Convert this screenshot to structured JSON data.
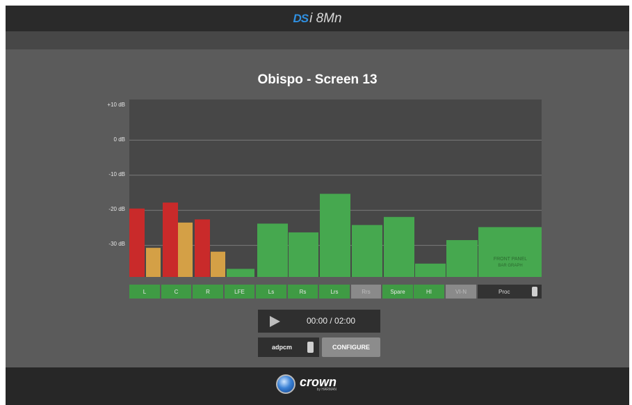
{
  "header": {
    "brand_mark": "DS",
    "brand_model": "i 8Mn"
  },
  "page": {
    "title": "Obispo - Screen 13"
  },
  "meter": {
    "y_labels": [
      "+10 dB",
      "0 dB",
      "-10 dB",
      "-20 dB",
      "-30 dB"
    ],
    "annotation_line1": "FRONT PANEL",
    "annotation_line2": "BAR GRAPH"
  },
  "chart_data": {
    "type": "bar",
    "ylim": [
      -40,
      10
    ],
    "bars": [
      {
        "channel": "L",
        "color": "#c92a2a",
        "value": -19.5
      },
      {
        "channel": "L",
        "color": "#d4a046",
        "value": -30.7
      },
      {
        "channel": "C",
        "color": "#c92a2a",
        "value": -17.8
      },
      {
        "channel": "C",
        "color": "#d4a046",
        "value": -23.5
      },
      {
        "channel": "R",
        "color": "#c92a2a",
        "value": -22.6
      },
      {
        "channel": "R",
        "color": "#d4a046",
        "value": -31.8
      },
      {
        "channel": "LFE",
        "color": "#46a84f",
        "value": -36.7
      },
      {
        "channel": "Ls",
        "color": "#46a84f",
        "value": -23.8
      },
      {
        "channel": "Rs",
        "color": "#46a84f",
        "value": -26.3
      },
      {
        "channel": "Lrs",
        "color": "#46a84f",
        "value": -15.3
      },
      {
        "channel": "Rrs",
        "color": "#46a84f",
        "value": -24.2
      },
      {
        "channel": "Spare",
        "color": "#46a84f",
        "value": -21.9
      },
      {
        "channel": "HI",
        "color": "#46a84f",
        "value": -35.2
      },
      {
        "channel": "VI-N",
        "color": "#46a84f",
        "value": -28.5
      },
      {
        "channel": "Proc",
        "color": "#46a84f",
        "value": -24.8
      }
    ]
  },
  "channels": [
    {
      "label": "L",
      "active": true
    },
    {
      "label": "C",
      "active": true
    },
    {
      "label": "R",
      "active": true
    },
    {
      "label": "LFE",
      "active": true
    },
    {
      "label": "Ls",
      "active": true
    },
    {
      "label": "Rs",
      "active": true
    },
    {
      "label": "Lrs",
      "active": true
    },
    {
      "label": "Rrs",
      "active": false
    },
    {
      "label": "Spare",
      "active": true
    },
    {
      "label": "HI",
      "active": true
    },
    {
      "label": "VI-N",
      "active": false
    },
    {
      "label": "Proc",
      "active": true
    }
  ],
  "player": {
    "time": "00:00 / 02:00"
  },
  "controls": {
    "codec": "adpcm",
    "configure_label": "CONFIGURE"
  },
  "footer": {
    "brand": "crown",
    "sub": "by HARMAN"
  }
}
